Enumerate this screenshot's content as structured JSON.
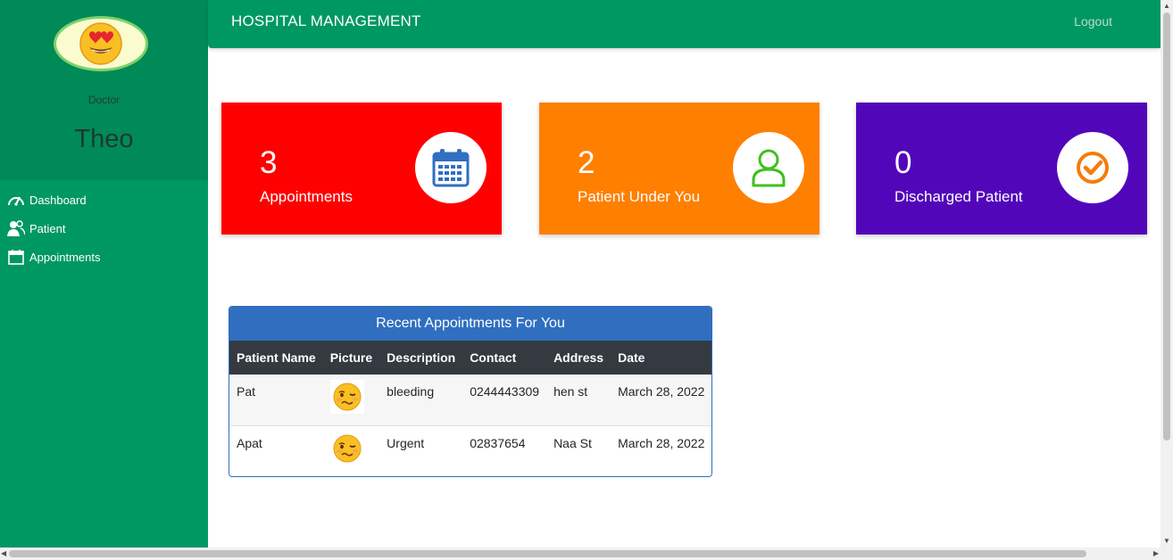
{
  "header": {
    "brand": "HOSPITAL MANAGEMENT",
    "logout_label": "Logout"
  },
  "sidebar": {
    "role": "Doctor",
    "name": "Theo",
    "items": [
      {
        "label": "Dashboard",
        "icon": "speedometer-icon"
      },
      {
        "label": "Patient",
        "icon": "users-icon"
      },
      {
        "label": "Appointments",
        "icon": "calendar-icon"
      }
    ]
  },
  "cards": [
    {
      "value": "3",
      "label": "Appointments",
      "color": "#ff0000",
      "icon": "calendar-icon"
    },
    {
      "value": "2",
      "label": "Patient Under You",
      "color": "#ff7f00",
      "icon": "user-icon"
    },
    {
      "value": "0",
      "label": "Discharged Patient",
      "color": "#5206ba",
      "icon": "check-circle-icon"
    }
  ],
  "appointments": {
    "title": "Recent Appointments For You",
    "columns": [
      "Patient Name",
      "Picture",
      "Description",
      "Contact",
      "Address",
      "Date"
    ],
    "rows": [
      {
        "patient": "Pat",
        "picture": "woozy-face-emoji",
        "description": "bleeding",
        "contact": "0244443309",
        "address": "hen st",
        "date": "March 28, 2022"
      },
      {
        "patient": "Apat",
        "picture": "woozy-face-emoji",
        "description": "Urgent",
        "contact": "02837654",
        "address": "Naa St",
        "date": "March 28, 2022"
      }
    ]
  },
  "colors": {
    "sidebar": "#009862",
    "profile": "#008a58",
    "table_header": "#306fc0",
    "table_columns": "#343a40"
  }
}
